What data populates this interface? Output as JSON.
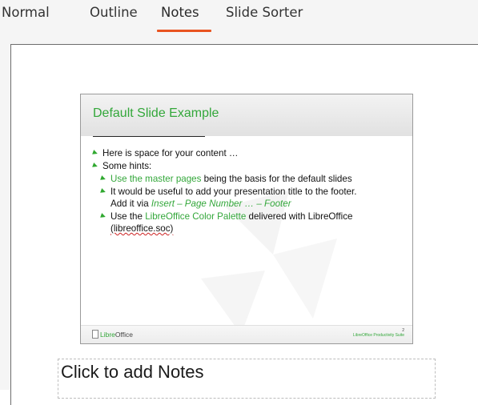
{
  "tabs": [
    {
      "label": "Normal",
      "active": false
    },
    {
      "label": "Outline",
      "active": false
    },
    {
      "label": "Notes",
      "active": true
    },
    {
      "label": "Slide Sorter",
      "active": false
    }
  ],
  "accent_color": "#e95420",
  "slide": {
    "title": "Default Slide Example",
    "bullets": {
      "b1": "Here is space for your content …",
      "b2": "Some hints:",
      "b3_link": "Use the master pages",
      "b3_rest": " being the basis for the default slides",
      "b4_line1": "It would be useful to add your presentation title to the footer.",
      "b4_prefix": "Add it via ",
      "b4_menu": "Insert – Page Number … – Footer",
      "b5_prefix": "Use the ",
      "b5_link": "LibreOffice Color Palette",
      "b5_rest": " delivered with LibreOffice",
      "b5_file": "(libreoffice.soc)"
    },
    "footer": {
      "logo_brand": "Libre",
      "logo_rest": "Office",
      "footer_text": "LibreOffice Productivity Suite",
      "page_number": "2"
    },
    "title_color": "#33a73a"
  },
  "notes": {
    "placeholder": "Click to add Notes"
  }
}
